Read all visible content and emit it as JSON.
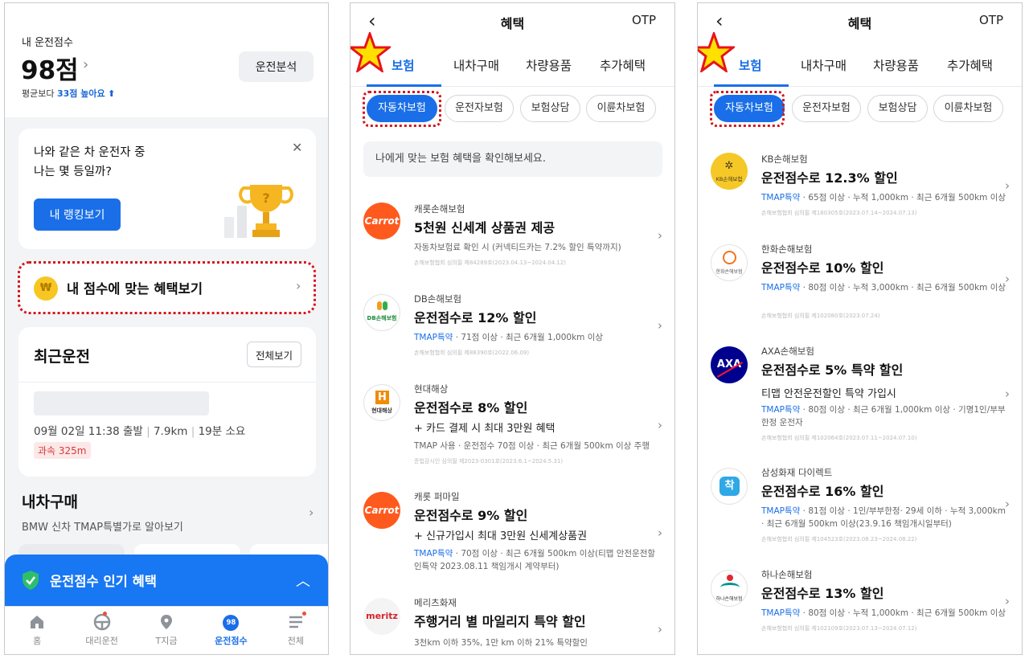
{
  "panel1": {
    "score_label": "내 운전점수",
    "score_value": "98점",
    "compare_prefix": "평균보다",
    "compare_highlight": "33점 높아요",
    "analysis_button": "운전분석",
    "rank_card": {
      "text": "나와 같은 차 운전자 중\n나는 몇 등일까?",
      "button": "내 랭킹보기"
    },
    "benefit_label": "내 점수에 맞는 혜택보기",
    "coin_symbol": "₩",
    "recent": {
      "title": "최근운전",
      "view_all": "전체보기",
      "date_time": "09월 02일 11:38 출발",
      "distance": "7.9km",
      "duration": "19분 소요",
      "speed_badge": "과속 325m"
    },
    "buy_car": {
      "title": "내차구매",
      "subtitle": "BMW 신차 TMAP특별가로 알아보기"
    },
    "popular_label": "운전점수 인기 혜택",
    "tabbar": [
      {
        "label": "홈",
        "icon": "home-icon"
      },
      {
        "label": "대리운전",
        "icon": "steering-wheel-icon"
      },
      {
        "label": "T지금",
        "icon": "location-pin-icon"
      },
      {
        "label": "운전점수",
        "icon": "score-icon",
        "badge": "98"
      },
      {
        "label": "전체",
        "icon": "menu-icon"
      }
    ],
    "colors": {
      "accent": "#1a6fe8",
      "popular_bar": "#1877f2",
      "highlight_border": "#d3171f"
    }
  },
  "header": {
    "back": "‹",
    "title": "혜택",
    "right": "OTP"
  },
  "tabs": [
    "보험",
    "내차구매",
    "차량용품",
    "추가혜택"
  ],
  "chips": [
    "자동차보험",
    "운전자보험",
    "보험상담",
    "이륜차보험"
  ],
  "panel2": {
    "notice": "나에게 맞는 보험 혜택을 확인해보세요.",
    "items": [
      {
        "company": "캐롯손해보험",
        "logo_text": "Carrot",
        "title": "5천원 신세계 상품권 제공",
        "sub": "",
        "tag": "",
        "cond": "자동차보험료 확인 시 (커넥티드카는 7.2% 할인 특약까지)",
        "reg": "손해보험협회 심의필 제84289호(2023.04.13~2024.04.12)"
      },
      {
        "company": "DB손해보험",
        "logo_text": "DB손해보험",
        "title": "운전점수로 12% 할인",
        "sub": "",
        "tag": "TMAP특약",
        "cond": " · 71점 이상 · 최근 6개월 1,000km 이상",
        "reg": "손해보험협회 심의필 제88390호(2022.06.09)"
      },
      {
        "company": "현대해상",
        "logo_text": "현대해상",
        "title": "운전점수로 8% 할인",
        "sub": "+ 카드 결제 시 최대 3만원 혜택",
        "tag": "",
        "cond": "TMAP 사용 · 운전점수 70점 이상 · 최근 6개월 500km 이상 주행",
        "reg": "준법감시인 심의필 제2023-0301호(2023.6.1~2024.5.31)"
      },
      {
        "company": "캐롯 퍼마일",
        "logo_text": "Carrot",
        "title": "운전점수로 9% 할인",
        "sub": "+ 신규가입시 최대 3만원 신세계상품권",
        "tag": "TMAP특약",
        "cond": " · 70점 이상 · 최근 6개월 500km 이상(티맵 안전운전할인특약 2023.08.11 책임개시 계약부터)",
        "reg": ""
      },
      {
        "company": "메리츠화재",
        "logo_text": "meritz",
        "title": "주행거리 별 마일리지 특약 할인",
        "sub": "",
        "tag": "",
        "cond": "3천km 이하 35%, 1만 km 이하 21% 특약할인",
        "reg": ""
      }
    ]
  },
  "panel3": {
    "items": [
      {
        "company": "KB손해보험",
        "logo_text": "KB손해보험",
        "title": "운전점수로 12.3% 할인",
        "sub": "",
        "tag": "TMAP특약",
        "cond": " · 65점 이상 · 누적 1,000km · 최근 6개월 500km 이상",
        "reg": "손해보험협회 심의필 제180305호(2023.07.14~2024.07.13)"
      },
      {
        "company": "한화손해보험",
        "logo_text": "한화손해보험",
        "title": "운전점수로 10% 할인",
        "sub": "",
        "tag": "TMAP특약",
        "cond": " · 80점 이상 · 누적 3,000km · 최근 6개월 500km 이상",
        "reg": "손해보험협회 심의필 제102080호(2023.07.24)"
      },
      {
        "company": "AXA손해보험",
        "logo_text": "AXA",
        "title": "운전점수로 5% 특약 할인",
        "sub": "티맵 안전운전할인 특약 가입시",
        "tag": "TMAP특약",
        "cond": " · 80점 이상 · 최근 6개월 1,000km 이상 · 기명1인/부부한정 운전자",
        "reg": "손해보험협회 심의필 제102064호(2023.07.11~2024.07.10)"
      },
      {
        "company": "삼성화재 다이렉트",
        "logo_text": "착",
        "title": "운전점수로 16% 할인",
        "sub": "",
        "tag": "TMAP특약",
        "cond": " · 81점 이상 · 1인/부부한정· 29세 이하 · 누적 3,000km · 최근 6개월 500km 이상(23.9.16 책임개시일부터)",
        "reg": "손해보험협회 심의필 제104523호(2023.08.23~2024.08.22)"
      },
      {
        "company": "하나손해보험",
        "logo_text": "하나손해보험",
        "title": "운전점수로 13% 할인",
        "sub": "",
        "tag": "TMAP특약",
        "cond": " · 80점 이상 · 누적 1,000km · 최근 6개월 500km 이상",
        "reg": "손해보험협회 심의필 제102109호(2023.07.13~2024.07.12)"
      }
    ]
  }
}
